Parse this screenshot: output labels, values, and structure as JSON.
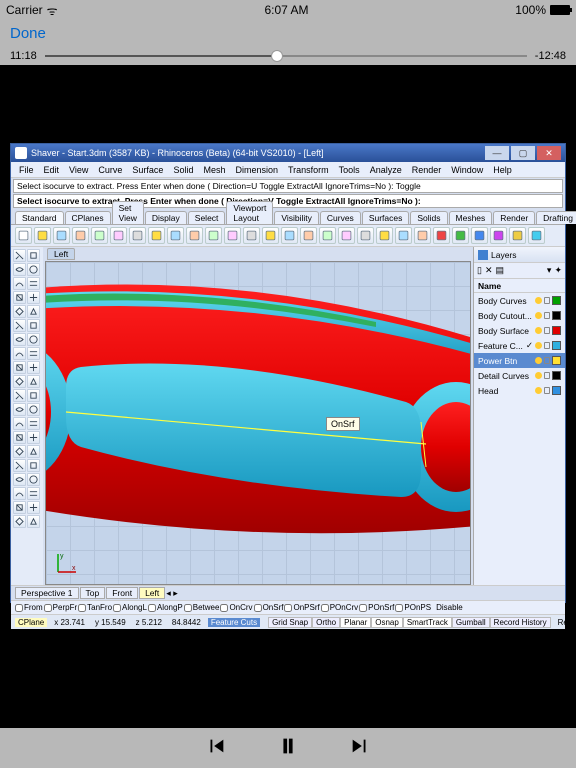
{
  "statusbar": {
    "carrier": "Carrier",
    "time": "6:07 AM",
    "battery": "100%"
  },
  "nav": {
    "done": "Done"
  },
  "scrubber": {
    "elapsed": "11:18",
    "remaining": "-12:48"
  },
  "app": {
    "title": "Shaver - Start.3dm (3587 KB) - Rhinoceros (Beta) (64-bit VS2010) - [Left]",
    "menus": [
      "File",
      "Edit",
      "View",
      "Curve",
      "Surface",
      "Solid",
      "Mesh",
      "Dimension",
      "Transform",
      "Tools",
      "Analyze",
      "Render",
      "Window",
      "Help"
    ],
    "cmd1": "Select isocurve to extract. Press Enter when done ( Direction=U  Toggle  ExtractAll  IgnoreTrims=No ): Toggle",
    "cmd2": "Select isocurve to extract. Press Enter when done ( Direction=V  Toggle  ExtractAll  IgnoreTrims=No ):",
    "tabs": [
      "Standard",
      "CPlanes",
      "Set View",
      "Display",
      "Select",
      "Viewport Layout",
      "Visibility",
      "Curves",
      "Surfaces",
      "Solids",
      "Meshes",
      "Render",
      "Drafting"
    ],
    "viewtab": "Left",
    "tooltip": "OnSrf",
    "panel": {
      "title": "Layers",
      "header": "Name"
    },
    "layers": [
      {
        "name": "Body Curves",
        "c": "#00a000",
        "sel": false
      },
      {
        "name": "Body Cutout...",
        "c": "#000000",
        "sel": false
      },
      {
        "name": "Body Surface",
        "c": "#e00000",
        "sel": false
      },
      {
        "name": "Feature C...",
        "c": "#30b0e0",
        "sel": false,
        "check": true
      },
      {
        "name": "Power Btn",
        "c": "#ffe033",
        "sel": true
      },
      {
        "name": "Detail Curves",
        "c": "#000000",
        "sel": false
      },
      {
        "name": "Head",
        "c": "#3090e0",
        "sel": false
      }
    ],
    "viewtabs": [
      "Perspective 1",
      "Top",
      "Front",
      "Left"
    ],
    "osnaps": [
      "From",
      "PerpFr",
      "TanFro",
      "AlongL",
      "AlongP",
      "Betwee",
      "OnCrv",
      "OnSrf",
      "OnPSrf",
      "POnCrv",
      "POnSrf",
      "POnPS"
    ],
    "disable": "Disable",
    "status": {
      "cplane": "CPlane",
      "x": "x 23.741",
      "y": "y 15.549",
      "z": "z 5.212",
      "d": "84.8442",
      "fc": "Feature Cuts",
      "toggles": [
        "Grid Snap",
        "Ortho",
        "Planar",
        "Osnap",
        "SmartTrack",
        "Gumball",
        "Record History"
      ],
      "rh": "Record Hi"
    }
  }
}
